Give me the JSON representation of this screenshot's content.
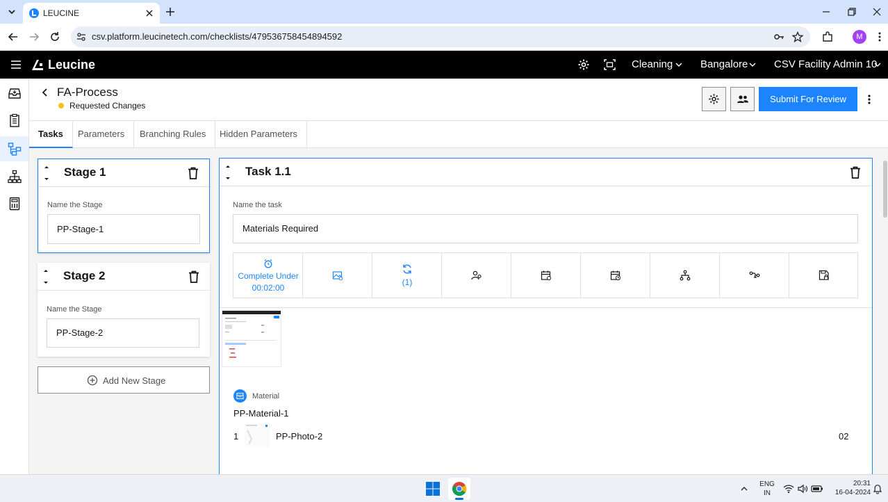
{
  "browser": {
    "tab_title": "LEUCINE",
    "url": "csv.platform.leucinetech.com/checklists/479536758454894592",
    "profile_initial": "M",
    "colors": {
      "tabstrip": "#d3e3fd",
      "profile": "#a142f4"
    }
  },
  "app": {
    "brand": "Leucine",
    "nav": {
      "module": "Cleaning",
      "facility": "Bangalore",
      "user": "CSV Facility Admin 10"
    },
    "colors": {
      "primary": "#1d84ff",
      "warning": "#f1c21b"
    }
  },
  "page": {
    "title": "FA-Process",
    "status": "Requested Changes",
    "submit_label": "Submit For Review",
    "tabs": [
      "Tasks",
      "Parameters",
      "Branching Rules",
      "Hidden Parameters"
    ]
  },
  "stages": [
    {
      "title": "Stage 1",
      "field_label": "Name the Stage",
      "value": "PP-Stage-1"
    },
    {
      "title": "Stage 2",
      "field_label": "Name the Stage",
      "value": "PP-Stage-2"
    }
  ],
  "add_stage_label": "Add New Stage",
  "task": {
    "title": "Task 1.1",
    "field_label": "Name the task",
    "value": "Materials Required",
    "timer_line1": "Complete Under",
    "timer_line2": "00:02:00",
    "recurrence_count": "(1)",
    "material_section_label": "Material",
    "material_name": "PP-Material-1",
    "material_row": {
      "index": "1",
      "name": "PP-Photo-2",
      "quantity": "02"
    }
  },
  "tool_icons": [
    "timer-icon",
    "image-upload-icon",
    "recurrence-icon",
    "assignee-icon",
    "schedule-icon",
    "due-date-icon",
    "branch-icon",
    "interlock-icon",
    "save-lock-icon"
  ],
  "taskbar": {
    "lang_line1": "ENG",
    "lang_line2": "IN",
    "time": "20:31",
    "date": "16-04-2024"
  }
}
